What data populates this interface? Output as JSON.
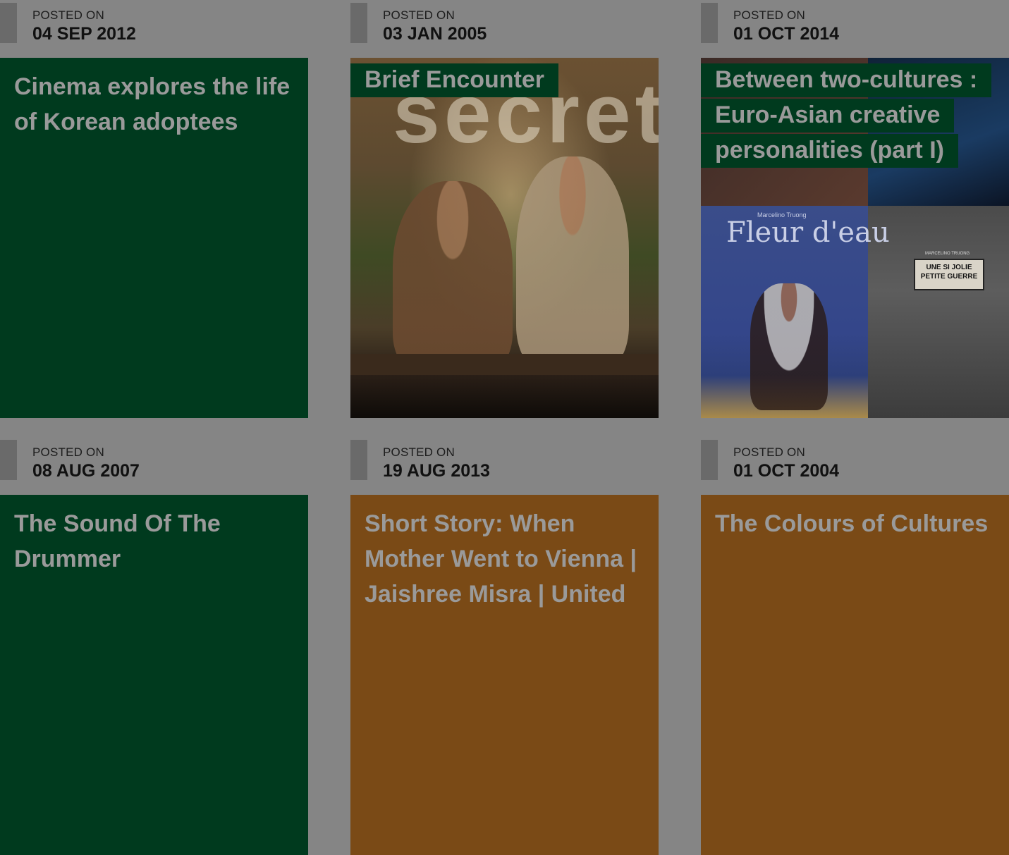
{
  "posted_label": "POSTED ON",
  "cards": [
    {
      "date": "04 SEP 2012",
      "title": "Cinema explores the life of Korean adoptees",
      "style": "green"
    },
    {
      "date": "03 JAN 2005",
      "title": "Brief Encounter",
      "style": "image-poster"
    },
    {
      "date": "01 OCT 2014",
      "title": "Between two-cultures : Euro-Asian creative personalities (part I)",
      "style": "image-collage"
    },
    {
      "date": "08 AUG 2007",
      "title": "The Sound Of The Drummer",
      "style": "green"
    },
    {
      "date": "19 AUG 2013",
      "title": "Short Story: When Mother Went to Vienna | Jaishree Misra | United",
      "style": "brown"
    },
    {
      "date": "01 OCT 2004",
      "title": "The Colours of Cultures",
      "style": "brown"
    }
  ],
  "art": {
    "poster_word": "secret",
    "collage_title": "Fleur d'eau",
    "collage_author": "Marcelino Truong",
    "collage_stamp": "UNE SI JOLIE PETITE GUERRE",
    "collage_stamp_author": "MARCELINO TRUONG"
  },
  "colors": {
    "overlay_gray": "#858585",
    "green_tile": "#003a1e",
    "brown_tile": "#7a4a16",
    "title_text": "#9a9a9a"
  }
}
